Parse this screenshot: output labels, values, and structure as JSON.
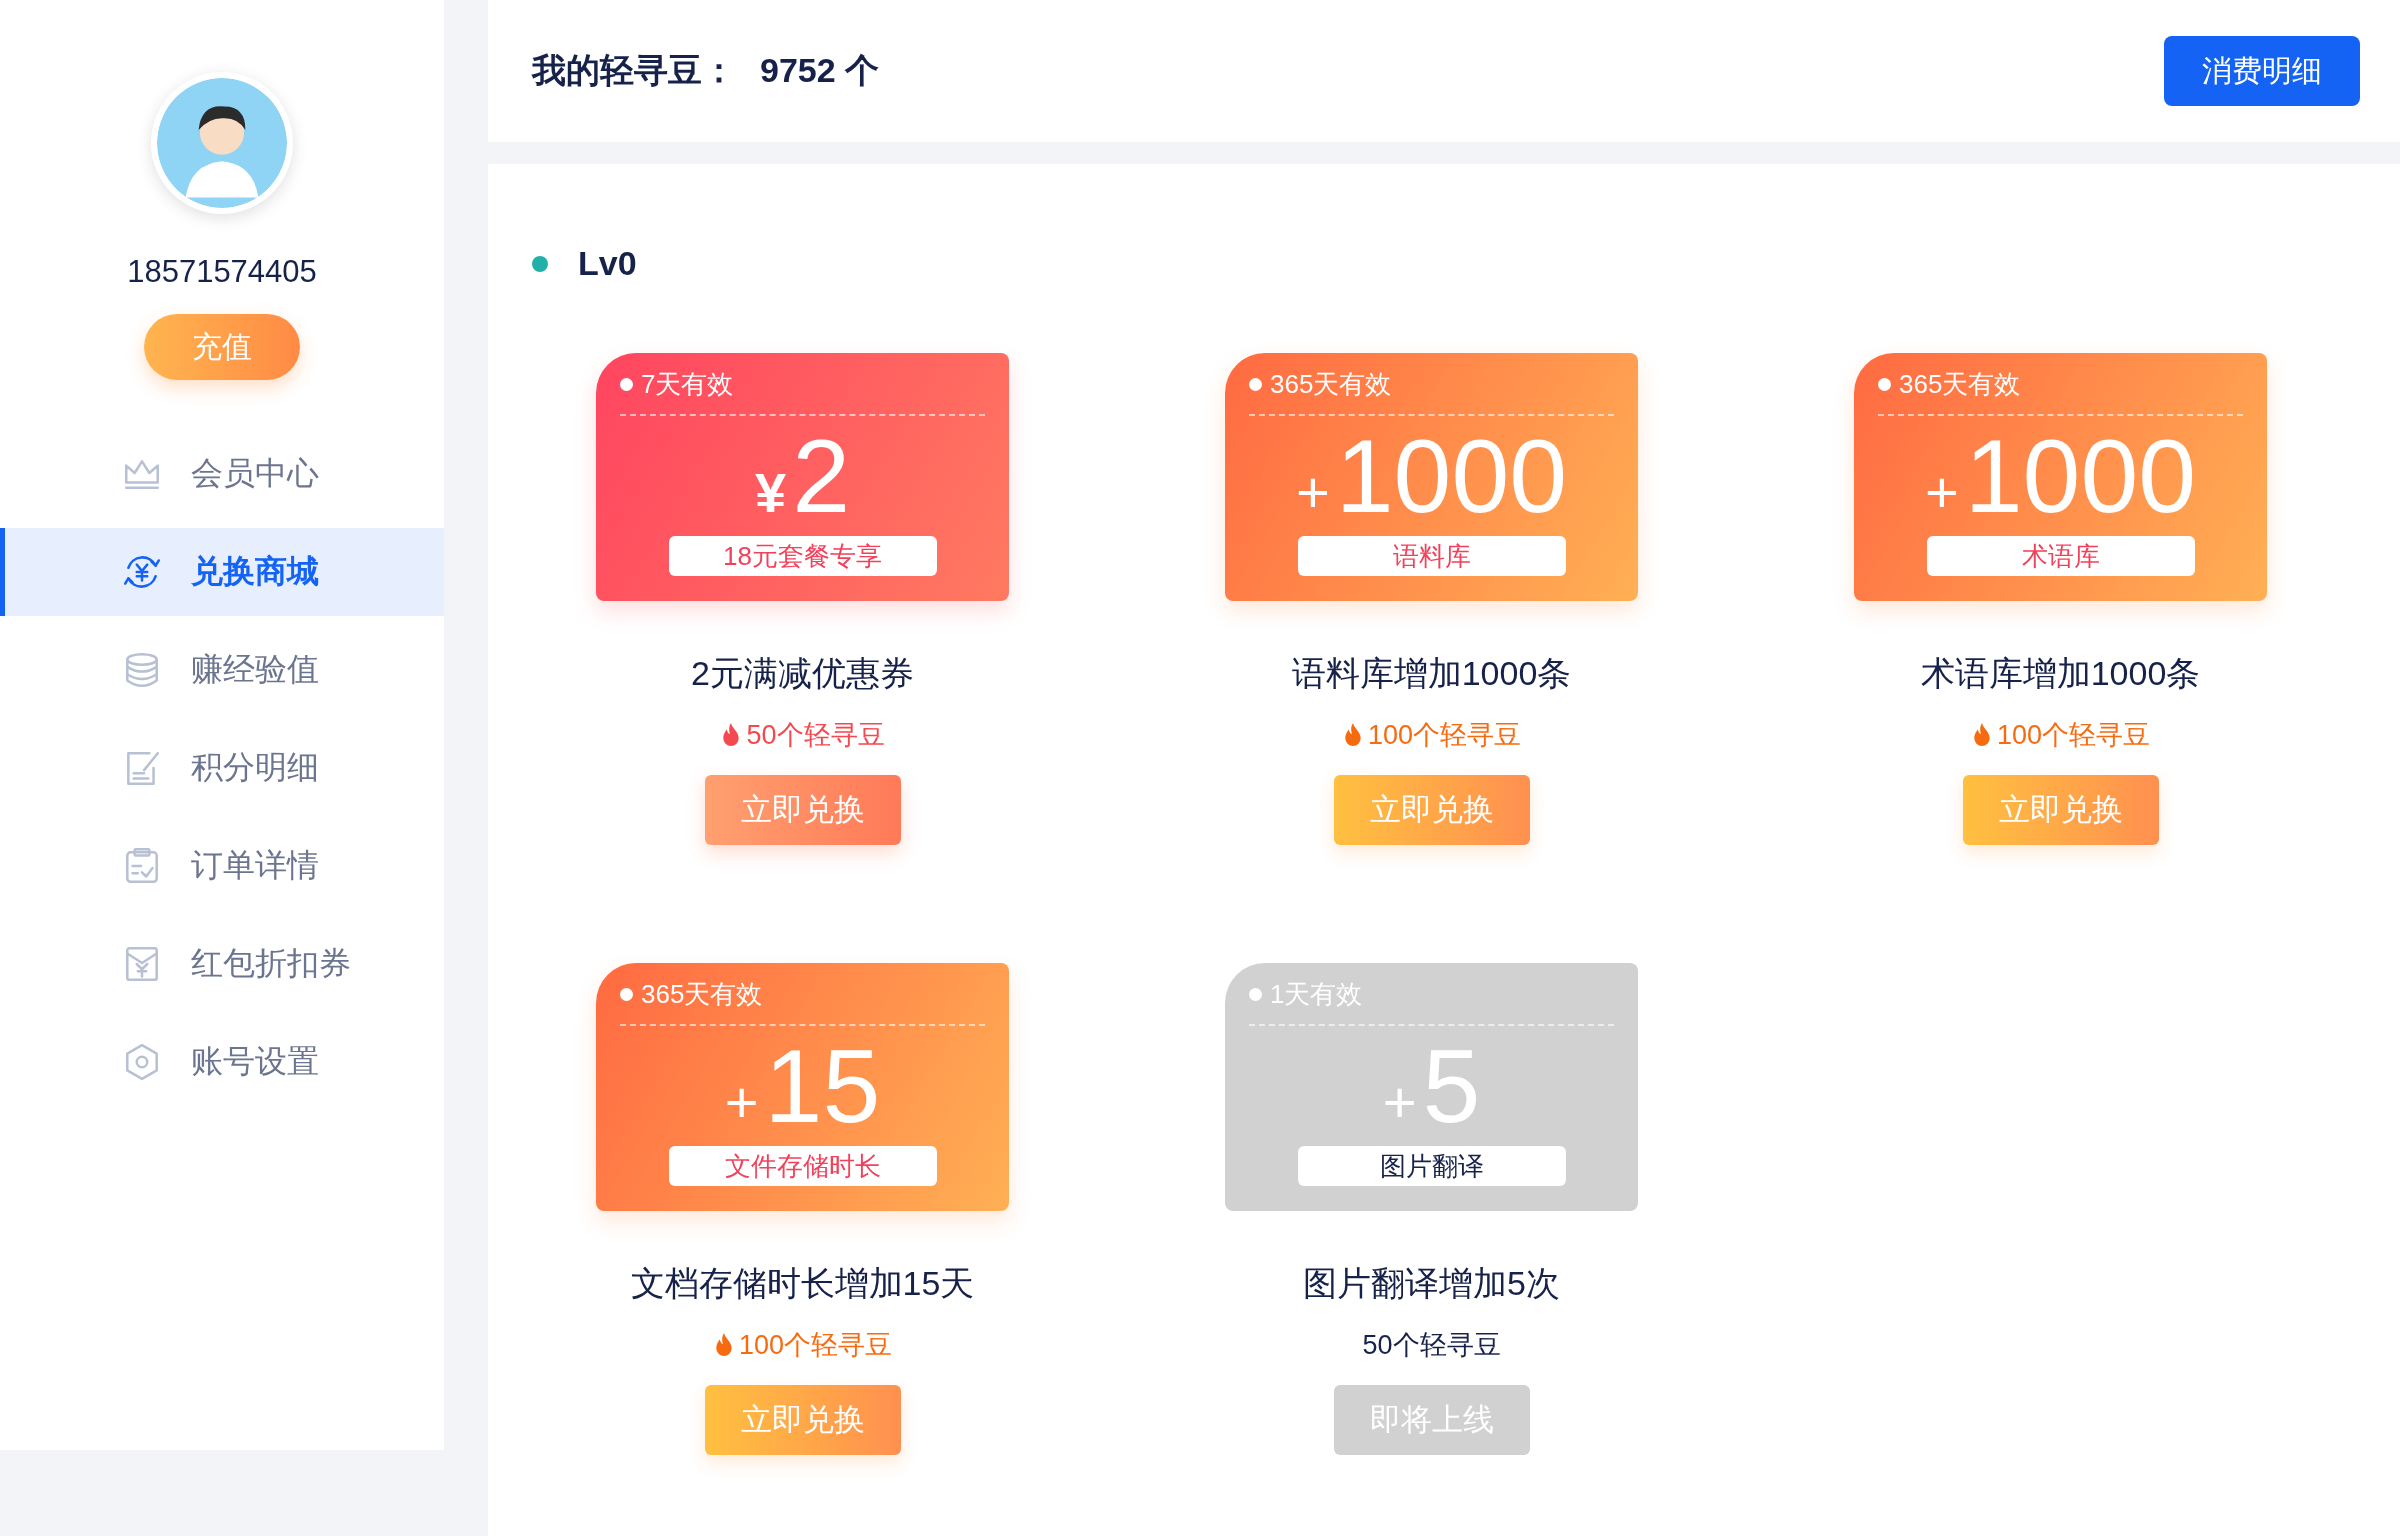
{
  "profile": {
    "phone": "18571574405",
    "recharge_button": "充值"
  },
  "sidebar": {
    "items": [
      {
        "label": "会员中心",
        "selected": false
      },
      {
        "label": "兑换商城",
        "selected": true
      },
      {
        "label": "赚经验值",
        "selected": false
      },
      {
        "label": "积分明细",
        "selected": false
      },
      {
        "label": "订单详情",
        "selected": false
      },
      {
        "label": "红包折扣券",
        "selected": false
      },
      {
        "label": "账号设置",
        "selected": false
      }
    ]
  },
  "header": {
    "balance_label": "我的轻寻豆：",
    "balance_value": "9752 个",
    "details_button": "消费明细"
  },
  "level": {
    "label": "Lv0"
  },
  "items": [
    {
      "kind": "coupon",
      "available": true,
      "validity": "7天有效",
      "prefix": "¥",
      "amount": "2",
      "tag": "18元套餐专享",
      "title": "2元满减优惠券",
      "price": "50个轻寻豆",
      "button": "立即兑换"
    },
    {
      "kind": "quota",
      "available": true,
      "validity": "365天有效",
      "prefix": "+",
      "amount": "1000",
      "tag": "语料库",
      "title": "语料库增加1000条",
      "price": "100个轻寻豆",
      "button": "立即兑换"
    },
    {
      "kind": "quota",
      "available": true,
      "validity": "365天有效",
      "prefix": "+",
      "amount": "1000",
      "tag": "术语库",
      "title": "术语库增加1000条",
      "price": "100个轻寻豆",
      "button": "立即兑换"
    },
    {
      "kind": "quota",
      "available": true,
      "validity": "365天有效",
      "prefix": "+",
      "amount": "15",
      "tag": "文件存储时长",
      "title": "文档存储时长增加15天",
      "price": "100个轻寻豆",
      "button": "立即兑换"
    },
    {
      "kind": "quota",
      "available": false,
      "validity": "1天有效",
      "prefix": "+",
      "amount": "5",
      "tag": "图片翻译",
      "title": "图片翻译增加5次",
      "price": "50个轻寻豆",
      "button": "即将上线"
    }
  ]
}
